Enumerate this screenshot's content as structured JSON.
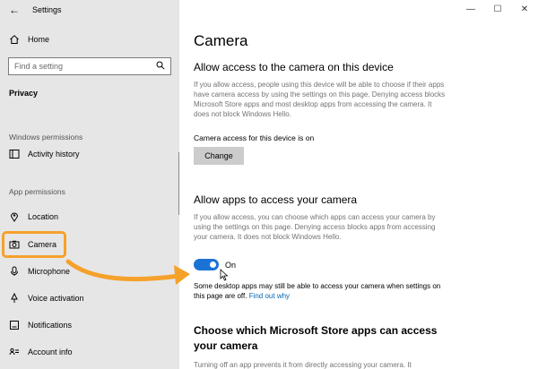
{
  "window": {
    "title": "Settings",
    "back_glyph": "←",
    "minimize": "—",
    "maximize": "☐",
    "close": "✕"
  },
  "sidebar": {
    "home": "Home",
    "search_placeholder": "Find a setting",
    "section": "Privacy",
    "windows_permissions_label": "Windows permissions",
    "activity_history": "Activity history",
    "app_permissions_label": "App permissions",
    "items": [
      "Location",
      "Camera",
      "Microphone",
      "Voice activation",
      "Notifications",
      "Account info"
    ]
  },
  "main": {
    "title": "Camera",
    "section1": {
      "heading": "Allow access to the camera on this device",
      "desc": "If you allow access, people using this device will be able to choose if their apps have camera access by using the settings on this page. Denying access blocks Microsoft Store apps and most desktop apps from accessing the camera. It does not block Windows Hello.",
      "status": "Camera access for this device is on",
      "button": "Change"
    },
    "section2": {
      "heading": "Allow apps to access your camera",
      "desc": "If you allow access, you can choose which apps can access your camera by using the settings on this page. Denying access blocks apps from accessing your camera. It does not block Windows Hello.",
      "toggle_label": "On",
      "toggle_on": true,
      "note": "Some desktop apps may still be able to access your camera when settings on this page are off.",
      "link": "Find out why"
    },
    "section3": {
      "heading": "Choose which Microsoft Store apps can access your camera",
      "desc": "Turning off an app prevents it from directly accessing your camera. It"
    }
  },
  "colors": {
    "accent": "#1a73d4",
    "highlight": "#f5a12a",
    "sidebar_bg": "#e6e6e6"
  }
}
